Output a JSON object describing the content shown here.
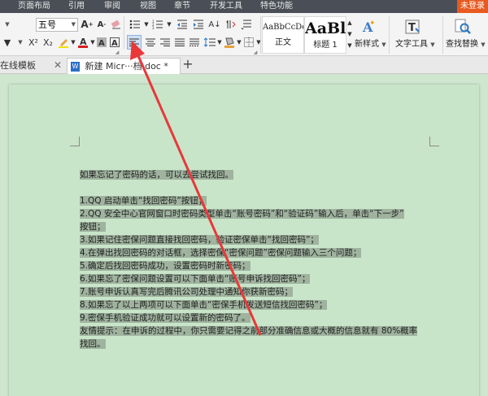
{
  "menu": {
    "items": [
      "页面布局",
      "引用",
      "审阅",
      "视图",
      "章节",
      "开发工具",
      "特色功能"
    ],
    "login": "未登录"
  },
  "ribbon": {
    "font_size": "五号",
    "styles": [
      {
        "sample": "AaBbCcDd",
        "name": "正文"
      },
      {
        "sample": "AaBl",
        "name": "标题 1"
      }
    ],
    "new_style": "新样式",
    "text_tools": "文字工具",
    "find_replace": "查找替换"
  },
  "tabs": [
    {
      "label": "在线模板",
      "active": false
    },
    {
      "label": "新建 Micr···档.doc *",
      "active": true
    }
  ],
  "document": {
    "lines": [
      "如果忘记了密码的话，可以去尝试找回。",
      "",
      "1.QQ 启动单击“找回密码”按钮；",
      "2.QQ 安全中心官网窗口时密码类型单击“账号密码”和“验证码”输入后，单击“下一步”",
      "按钮；",
      "3.如果记住密保问题直接找回密码，验证密保单击“找回密码”；",
      "4.在弹出找回密码的对话框，选择密保“密保问题”密保问题输入三个问题；",
      "5.确定后找回密码成功，设置密码时新密码；",
      "6.如果忘了密保问题设置可以下面单击“账号申诉找回密码”；",
      "7.账号申诉认真写完后腾讯公司处理中通知你获新密码；",
      "8.如果忘了以上两项可以下面单击“密保手机发送短信找回密码”；",
      "9.密保手机验证成功就可以设置新的密码了。",
      "友情提示：在申诉的过程中，你只需要记得之前部分准确信息或大概的信息就有 80%概率",
      "找回。"
    ]
  },
  "colors": {
    "menubar_bg": "#4a4f57",
    "login_bg": "#e85a20",
    "doc_bg": "#c9e5c9",
    "highlight": "#9fb39f",
    "arrow": "#e8383a"
  }
}
